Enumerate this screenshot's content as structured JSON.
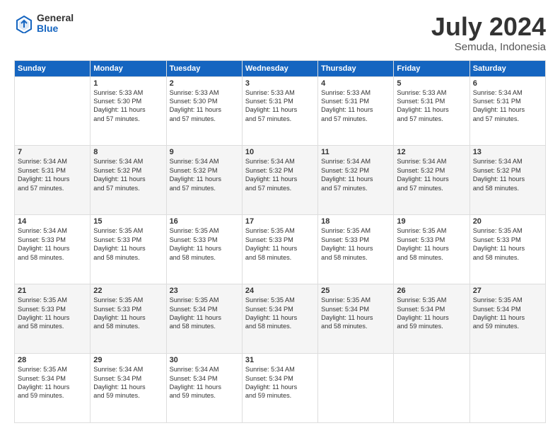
{
  "logo": {
    "general": "General",
    "blue": "Blue"
  },
  "title": "July 2024",
  "subtitle": "Semuda, Indonesia",
  "days_of_week": [
    "Sunday",
    "Monday",
    "Tuesday",
    "Wednesday",
    "Thursday",
    "Friday",
    "Saturday"
  ],
  "weeks": [
    [
      {
        "day": "",
        "info": ""
      },
      {
        "day": "1",
        "info": "Sunrise: 5:33 AM\nSunset: 5:30 PM\nDaylight: 11 hours\nand 57 minutes."
      },
      {
        "day": "2",
        "info": "Sunrise: 5:33 AM\nSunset: 5:30 PM\nDaylight: 11 hours\nand 57 minutes."
      },
      {
        "day": "3",
        "info": "Sunrise: 5:33 AM\nSunset: 5:31 PM\nDaylight: 11 hours\nand 57 minutes."
      },
      {
        "day": "4",
        "info": "Sunrise: 5:33 AM\nSunset: 5:31 PM\nDaylight: 11 hours\nand 57 minutes."
      },
      {
        "day": "5",
        "info": "Sunrise: 5:33 AM\nSunset: 5:31 PM\nDaylight: 11 hours\nand 57 minutes."
      },
      {
        "day": "6",
        "info": "Sunrise: 5:34 AM\nSunset: 5:31 PM\nDaylight: 11 hours\nand 57 minutes."
      }
    ],
    [
      {
        "day": "7",
        "info": "Sunrise: 5:34 AM\nSunset: 5:31 PM\nDaylight: 11 hours\nand 57 minutes."
      },
      {
        "day": "8",
        "info": "Sunrise: 5:34 AM\nSunset: 5:32 PM\nDaylight: 11 hours\nand 57 minutes."
      },
      {
        "day": "9",
        "info": "Sunrise: 5:34 AM\nSunset: 5:32 PM\nDaylight: 11 hours\nand 57 minutes."
      },
      {
        "day": "10",
        "info": "Sunrise: 5:34 AM\nSunset: 5:32 PM\nDaylight: 11 hours\nand 57 minutes."
      },
      {
        "day": "11",
        "info": "Sunrise: 5:34 AM\nSunset: 5:32 PM\nDaylight: 11 hours\nand 57 minutes."
      },
      {
        "day": "12",
        "info": "Sunrise: 5:34 AM\nSunset: 5:32 PM\nDaylight: 11 hours\nand 57 minutes."
      },
      {
        "day": "13",
        "info": "Sunrise: 5:34 AM\nSunset: 5:32 PM\nDaylight: 11 hours\nand 58 minutes."
      }
    ],
    [
      {
        "day": "14",
        "info": "Sunrise: 5:34 AM\nSunset: 5:33 PM\nDaylight: 11 hours\nand 58 minutes."
      },
      {
        "day": "15",
        "info": "Sunrise: 5:35 AM\nSunset: 5:33 PM\nDaylight: 11 hours\nand 58 minutes."
      },
      {
        "day": "16",
        "info": "Sunrise: 5:35 AM\nSunset: 5:33 PM\nDaylight: 11 hours\nand 58 minutes."
      },
      {
        "day": "17",
        "info": "Sunrise: 5:35 AM\nSunset: 5:33 PM\nDaylight: 11 hours\nand 58 minutes."
      },
      {
        "day": "18",
        "info": "Sunrise: 5:35 AM\nSunset: 5:33 PM\nDaylight: 11 hours\nand 58 minutes."
      },
      {
        "day": "19",
        "info": "Sunrise: 5:35 AM\nSunset: 5:33 PM\nDaylight: 11 hours\nand 58 minutes."
      },
      {
        "day": "20",
        "info": "Sunrise: 5:35 AM\nSunset: 5:33 PM\nDaylight: 11 hours\nand 58 minutes."
      }
    ],
    [
      {
        "day": "21",
        "info": "Sunrise: 5:35 AM\nSunset: 5:33 PM\nDaylight: 11 hours\nand 58 minutes."
      },
      {
        "day": "22",
        "info": "Sunrise: 5:35 AM\nSunset: 5:33 PM\nDaylight: 11 hours\nand 58 minutes."
      },
      {
        "day": "23",
        "info": "Sunrise: 5:35 AM\nSunset: 5:34 PM\nDaylight: 11 hours\nand 58 minutes."
      },
      {
        "day": "24",
        "info": "Sunrise: 5:35 AM\nSunset: 5:34 PM\nDaylight: 11 hours\nand 58 minutes."
      },
      {
        "day": "25",
        "info": "Sunrise: 5:35 AM\nSunset: 5:34 PM\nDaylight: 11 hours\nand 58 minutes."
      },
      {
        "day": "26",
        "info": "Sunrise: 5:35 AM\nSunset: 5:34 PM\nDaylight: 11 hours\nand 59 minutes."
      },
      {
        "day": "27",
        "info": "Sunrise: 5:35 AM\nSunset: 5:34 PM\nDaylight: 11 hours\nand 59 minutes."
      }
    ],
    [
      {
        "day": "28",
        "info": "Sunrise: 5:35 AM\nSunset: 5:34 PM\nDaylight: 11 hours\nand 59 minutes."
      },
      {
        "day": "29",
        "info": "Sunrise: 5:34 AM\nSunset: 5:34 PM\nDaylight: 11 hours\nand 59 minutes."
      },
      {
        "day": "30",
        "info": "Sunrise: 5:34 AM\nSunset: 5:34 PM\nDaylight: 11 hours\nand 59 minutes."
      },
      {
        "day": "31",
        "info": "Sunrise: 5:34 AM\nSunset: 5:34 PM\nDaylight: 11 hours\nand 59 minutes."
      },
      {
        "day": "",
        "info": ""
      },
      {
        "day": "",
        "info": ""
      },
      {
        "day": "",
        "info": ""
      }
    ]
  ]
}
